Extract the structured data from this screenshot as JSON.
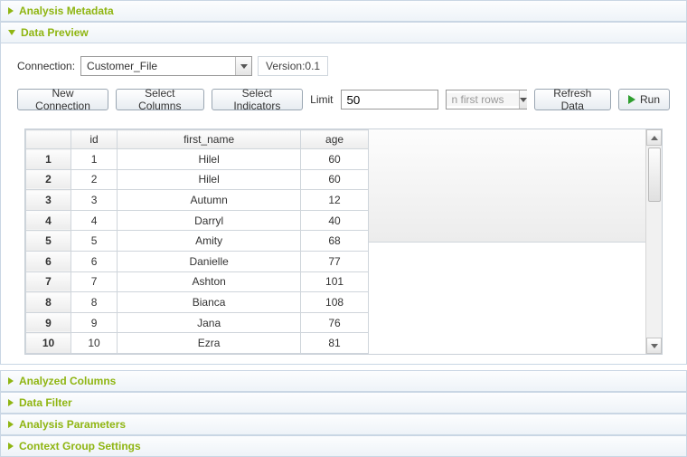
{
  "sections": {
    "analysis_metadata": "Analysis Metadata",
    "data_preview": "Data Preview",
    "analyzed_columns": "Analyzed Columns",
    "data_filter": "Data Filter",
    "analysis_parameters": "Analysis Parameters",
    "context_group_settings": "Context Group Settings"
  },
  "connection": {
    "label": "Connection:",
    "value": "Customer_File",
    "version": "Version:0.1"
  },
  "toolbar": {
    "new_connection": "New Connection",
    "select_columns": "Select Columns",
    "select_indicators": "Select Indicators",
    "limit_label": "Limit",
    "limit_value": "50",
    "rows_mode": "n first rows",
    "refresh_data": "Refresh Data",
    "run": "Run"
  },
  "table": {
    "columns": [
      "id",
      "first_name",
      "age"
    ],
    "rows": [
      {
        "n": "1",
        "id": "1",
        "first_name": "Hilel",
        "age": "60"
      },
      {
        "n": "2",
        "id": "2",
        "first_name": "Hilel",
        "age": "60"
      },
      {
        "n": "3",
        "id": "3",
        "first_name": "Autumn",
        "age": "12"
      },
      {
        "n": "4",
        "id": "4",
        "first_name": "Darryl",
        "age": "40"
      },
      {
        "n": "5",
        "id": "5",
        "first_name": "Amity",
        "age": "68"
      },
      {
        "n": "6",
        "id": "6",
        "first_name": "Danielle",
        "age": "77"
      },
      {
        "n": "7",
        "id": "7",
        "first_name": "Ashton",
        "age": "101"
      },
      {
        "n": "8",
        "id": "8",
        "first_name": "Bianca",
        "age": "108"
      },
      {
        "n": "9",
        "id": "9",
        "first_name": "Jana",
        "age": "76"
      },
      {
        "n": "10",
        "id": "10",
        "first_name": "Ezra",
        "age": "81"
      }
    ]
  }
}
